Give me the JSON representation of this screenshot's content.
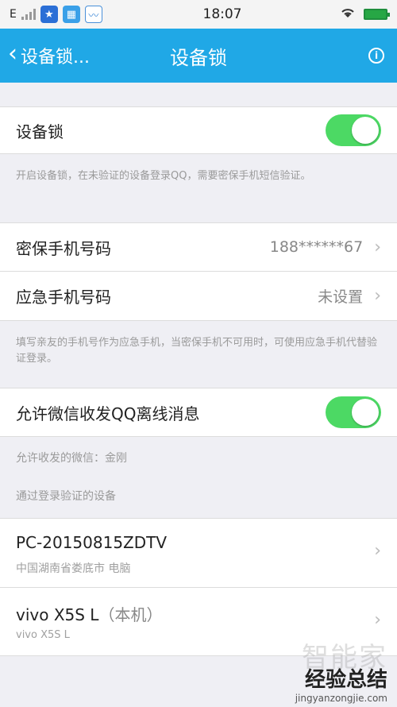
{
  "status_bar": {
    "carrier": "E",
    "time": "18:07"
  },
  "nav": {
    "back_label": "设备锁...",
    "title": "设备锁"
  },
  "device_lock": {
    "label": "设备锁",
    "enabled": true,
    "note": "开启设备锁，在未验证的设备登录QQ，需要密保手机短信验证。"
  },
  "phones": {
    "security_label": "密保手机号码",
    "security_value": "188******67",
    "emergency_label": "应急手机号码",
    "emergency_value": "未设置",
    "note": "填写亲友的手机号作为应急手机，当密保手机不可用时，可使用应急手机代替验证登录。"
  },
  "wechat": {
    "label": "允许微信收发QQ离线消息",
    "enabled": true,
    "allowed_note": "允许收发的微信：金刚"
  },
  "verified_devices": {
    "header": "通过登录验证的设备",
    "items": [
      {
        "name": "PC-20150815ZDTV",
        "sub": "中国湖南省娄底市 电脑"
      },
      {
        "name": "vivo X5S L",
        "tag": "（本机）",
        "sub": "vivo X5S L"
      }
    ]
  },
  "watermark": {
    "line1": "智能家",
    "line2": "经验总结",
    "line3": "jingyanzongjie.com"
  },
  "colors": {
    "nav_blue": "#20a8e6",
    "toggle_green": "#4cd964"
  }
}
